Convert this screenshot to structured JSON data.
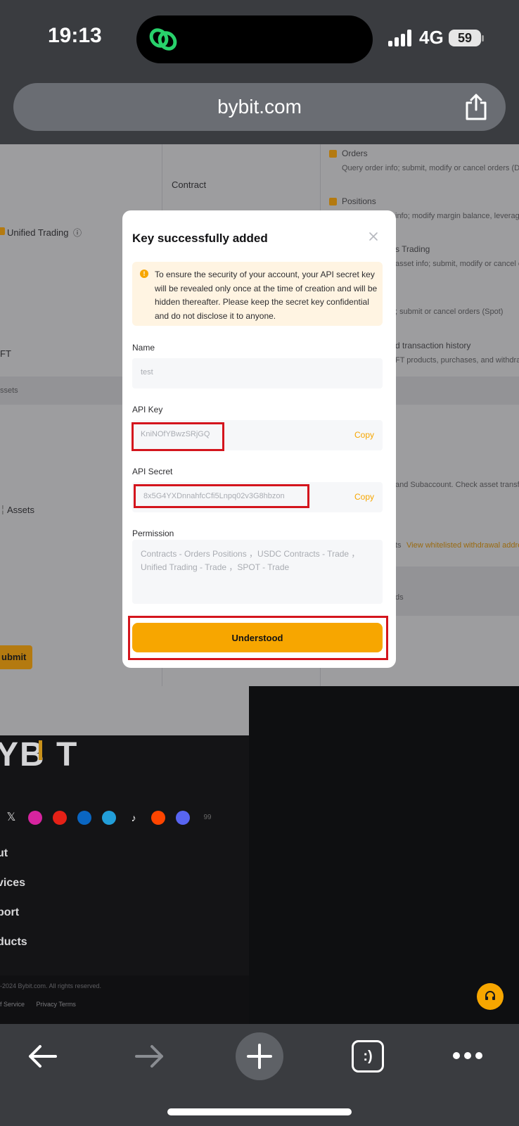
{
  "status_bar": {
    "time": "19:13",
    "network": "4G",
    "battery": "59"
  },
  "browser": {
    "url": "bybit.com"
  },
  "background_page": {
    "contract_label": "Contract",
    "unified_trading_label": "Unified Trading",
    "nft_label": "FT",
    "assets_section": "ssets",
    "assets_label": "Assets",
    "submit_label": "ubmit",
    "permissions": [
      {
        "title": "Orders",
        "desc": "Query order info; submit, modify or cancel orders (Der"
      },
      {
        "title": "Positions",
        "desc": "info; modify margin balance, leverage"
      },
      {
        "title": "s Trading",
        "desc": "asset info; submit, modify or cancel c"
      },
      {
        "title": "",
        "desc": "; submit or cancel orders (Spot)"
      },
      {
        "title": "d transaction history",
        "desc": "FT products, purchases, and withdra"
      }
    ],
    "subaccount_text": "and Subaccount. Check asset transfe",
    "whitelist_prefix": "ts",
    "whitelist_link": "View whitelisted withdrawal addre",
    "ds_text": "ds",
    "footer": {
      "logo": "YB T",
      "links": [
        "ut",
        "vices",
        "port",
        "ducts"
      ],
      "copyright": "-2024 Bybit.com. All rights reserved.",
      "terms": [
        "f Service",
        "Privacy Terms"
      ]
    }
  },
  "modal": {
    "title": "Key successfully added",
    "notice": "To ensure the security of your account, your API secret key will be revealed only once at the time of creation and will be hidden thereafter. Please keep the secret key confidential and do not disclose it to anyone.",
    "name_label": "Name",
    "name_value": "test",
    "api_key_label": "API Key",
    "api_key_value": "KniNOfYBwzSRjGQ",
    "api_secret_label": "API Secret",
    "api_secret_value": "8x5G4YXDnnahfcCfi5Lnpq02v3G8hbzon",
    "copy_label": "Copy",
    "permission_label": "Permission",
    "permission_value": "Contracts - Orders Positions ，USDC Contracts - Trade ，Unified Trading - Trade ，SPOT - Trade",
    "button_label": "Understood"
  },
  "toolbar": {
    "tabs_label": ":)"
  },
  "colors": {
    "accent": "#f7a600",
    "highlight": "#d4151d"
  }
}
